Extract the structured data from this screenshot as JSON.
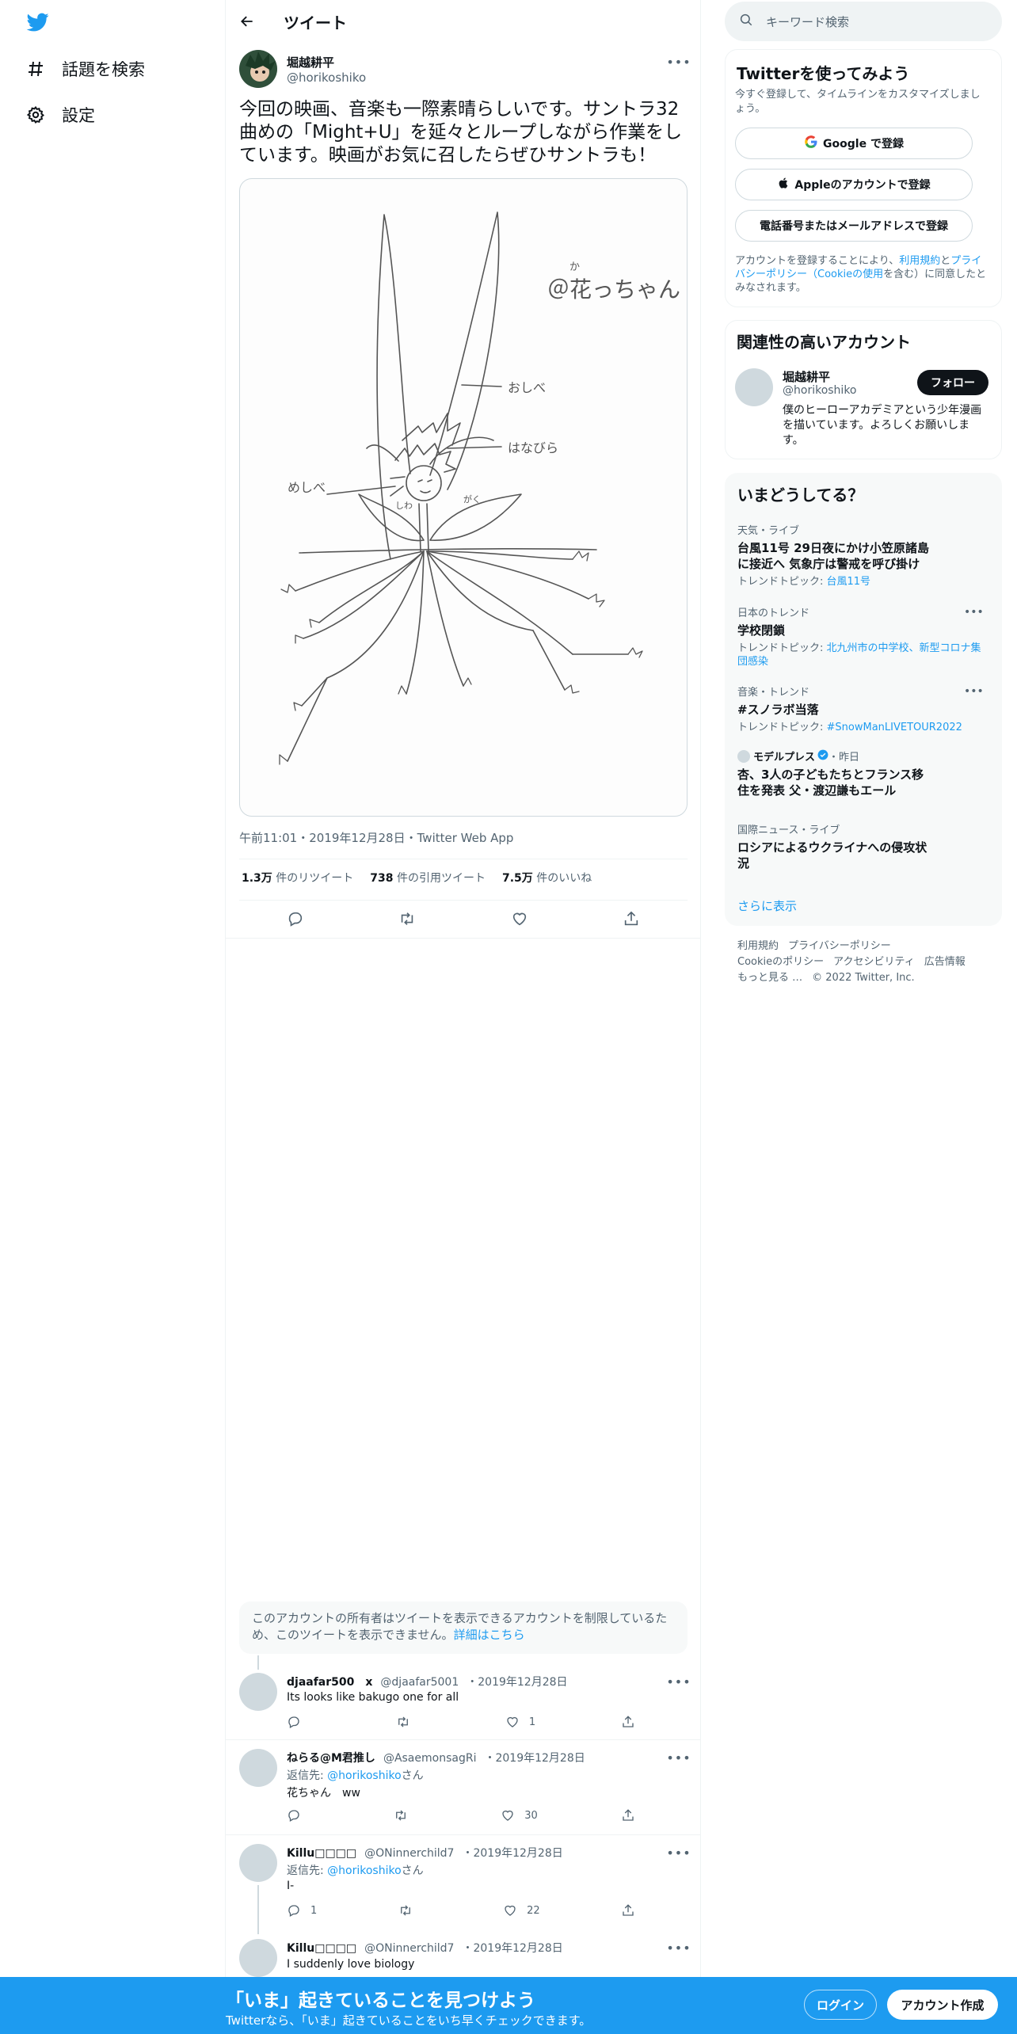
{
  "nav": {
    "items": [
      {
        "label": "話題を検索",
        "icon": "hashtag-icon"
      },
      {
        "label": "設定",
        "icon": "gear-icon"
      }
    ]
  },
  "header": {
    "title": "ツイート"
  },
  "tweet": {
    "name": "堀越耕平",
    "handle": "@horikoshiko",
    "text": "今回の映画、音楽も一際素晴らしいです。サントラ32曲めの「Might+U」を延々とループしながら作業をしています。映画がお気に召したらぜひサントラも！",
    "drawing_labels": {
      "title": "＠花っちゃん",
      "ruby": "か",
      "ear": "おしべ",
      "petal": "はなびら",
      "pistil": "めしべ",
      "leaf_left": "しわ",
      "leaf_right": "がく"
    },
    "time": "午前11:01",
    "date": "2019年12月28日",
    "source": "Twitter Web App",
    "stats": {
      "retweets_value": "1.3万",
      "retweets_label": "件のリツイート",
      "quotes_value": "738",
      "quotes_label": "件の引用ツイート",
      "likes_value": "7.5万",
      "likes_label": "件のいいね"
    }
  },
  "notice": {
    "text": "このアカウントの所有者はツイートを表示できるアカウントを制限しているため、このツイートを表示できません。",
    "link": "詳細はこちら"
  },
  "replies": [
    {
      "name": "djaafar500　x",
      "handle": "@djaafar5001",
      "date": "2019年12月28日",
      "reply_to": "",
      "reply_to_prefix": "",
      "reply_to_suffix": "",
      "text": "Its looks like bakugo one for all",
      "reply_count": "",
      "retweet_count": "",
      "like_count": "1"
    },
    {
      "name": "ねらる@M君推し",
      "handle": "@AsaemonsagRi",
      "date": "2019年12月28日",
      "reply_to_prefix": "返信先: ",
      "reply_to": "@horikoshiko",
      "reply_to_suffix": "さん",
      "text": "花ちゃん　ww",
      "reply_count": "",
      "retweet_count": "",
      "like_count": "30"
    },
    {
      "name": "Killu□□□□",
      "handle": "@ONinnerchild7",
      "date": "2019年12月28日",
      "reply_to_prefix": "返信先: ",
      "reply_to": "@horikoshiko",
      "reply_to_suffix": "さん",
      "text": "I-",
      "reply_count": "1",
      "retweet_count": "",
      "like_count": "22"
    },
    {
      "name": "Killu□□□□",
      "handle": "@ONinnerchild7",
      "date": "2019年12月28日",
      "reply_to": "",
      "reply_to_prefix": "",
      "reply_to_suffix": "",
      "text": "I suddenly love biology"
    }
  ],
  "search": {
    "placeholder": "キーワード検索"
  },
  "signup": {
    "title": "Twitterを使ってみよう",
    "subtitle": "今すぐ登録して、タイムラインをカスタマイズしましょう。",
    "google": "Google で登録",
    "apple": "Appleのアカウントで登録",
    "phone": "電話番号またはメールアドレスで登録",
    "legal_1": "アカウントを登録することにより、",
    "legal_terms": "利用規約",
    "legal_2": "と",
    "legal_privacy": "プライバシーポリシー（Cookieの使用",
    "legal_3": "を含む）に同意したとみなされます。"
  },
  "related": {
    "title": "関連性の高いアカウント",
    "name": "堀越耕平",
    "handle": "@horikoshiko",
    "follow": "フォロー",
    "bio": "僕のヒーローアカデミアという少年漫画を描いています。よろしくお願いします。"
  },
  "trends": {
    "title": "いまどうしてる？",
    "items": [
      {
        "category": "天気・ライブ",
        "title": "台風11号 29日夜にかけ小笠原諸島に接近へ 気象庁は警戒を呼び掛け",
        "topic_prefix": "トレンドトピック: ",
        "topic": "台風11号"
      },
      {
        "category": "日本のトレンド",
        "title": "学校閉鎖",
        "topic_prefix": "トレンドトピック: ",
        "topic": "北九州市の中学校、新型コロナ集団感染"
      },
      {
        "category": "音楽・トレンド",
        "title": "#スノラボ当落",
        "topic_prefix": "トレンドトピック: ",
        "topic": "#SnowManLIVETOUR2022"
      },
      {
        "category": "モデルプレス",
        "category_suffix": "・昨日",
        "title": "杏、3人の子どもたちとフランス移住を発表 父・渡辺謙もエール"
      },
      {
        "category": "国際ニュース・ライブ",
        "title": "ロシアによるウクライナへの侵攻状況"
      }
    ],
    "more": "さらに表示"
  },
  "footer": {
    "links": [
      "利用規約",
      "プライバシーポリシー",
      "Cookieのポリシー",
      "アクセシビリティ",
      "広告情報",
      "もっと見る …",
      "© 2022 Twitter, Inc."
    ]
  },
  "bottombar": {
    "title": "「いま」起きていることを見つけよう",
    "subtitle": "Twitterなら、「いま」起きていることをいち早くチェックできます。",
    "login": "ログイン",
    "signup": "アカウント作成"
  },
  "colors": {
    "accent": "#1d9bf0",
    "text": "#0f1419",
    "secondary": "#536471",
    "border": "#eff3f4"
  }
}
